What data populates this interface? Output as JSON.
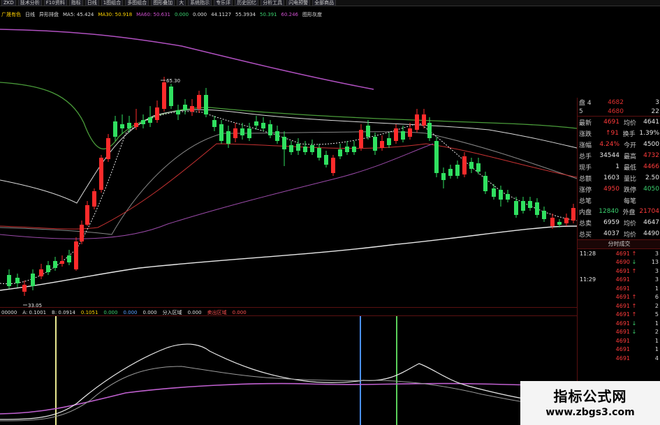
{
  "toolbar": {
    "items": [
      "ZKD",
      "技术分析",
      "F10资料",
      "指标",
      "日线",
      "1图组合",
      "多图组合",
      "图形叠加",
      "大",
      "系统指示",
      "专乐评",
      "历史回忆",
      "分析工具",
      "闪电预警",
      "全部商品"
    ]
  },
  "info": {
    "stock_name": "广晟有色",
    "period": "日线",
    "mode": "异形排盘",
    "ma5": "MA5: 45.424",
    "ma30": "MA30: 50.918",
    "ma60": "MA60: 50.631",
    "ma120": "0.000",
    "ma_b": "0.000",
    "extra1": "44.1127",
    "extra2": "55.3934",
    "extra3": "50.391",
    "extra4": "60.246",
    "extra5": "图形灰度"
  },
  "price_labels": {
    "high": "65.30",
    "low": "33.05"
  },
  "indicator_bar": {
    "name": "00000",
    "a": "A: 0.1001",
    "b": "B: 0.0914",
    "c": "0.1051",
    "d": "0.000",
    "e": "0.000",
    "f": "0.000",
    "g": "0.000",
    "h": "0.000",
    "label_buy": "分入区域",
    "label_sell": "卖出区域"
  },
  "orderbook": [
    {
      "label": "盘 4",
      "price": "4682",
      "vol": "3"
    },
    {
      "label": "5",
      "price": "4680",
      "vol": "22"
    }
  ],
  "quote": [
    {
      "k1": "最新",
      "v1": "4691",
      "k2": "均价",
      "v2": "4641",
      "c1": "red",
      "c2": "white"
    },
    {
      "k1": "涨跌",
      "v1": "↑91",
      "k2": "换手",
      "v2": "1.39%",
      "c1": "red",
      "c2": "white"
    },
    {
      "k1": "涨幅",
      "v1": "4.24%",
      "k2": "今开",
      "v2": "4500",
      "c1": "red",
      "c2": "white"
    },
    {
      "k1": "总手",
      "v1": "34544",
      "k2": "最高",
      "v2": "4732",
      "c1": "white",
      "c2": "red"
    },
    {
      "k1": "现手",
      "v1": "1",
      "k2": "最低",
      "v2": "4466",
      "c1": "white",
      "c2": "red"
    },
    {
      "k1": "总额",
      "v1": "1603",
      "k2": "量比",
      "v2": "2.50",
      "c1": "white",
      "c2": "white"
    },
    {
      "k1": "涨停",
      "v1": "4950",
      "k2": "跌停",
      "v2": "4050",
      "c1": "red",
      "c2": "green"
    },
    {
      "k1": "总笔",
      "v1": "",
      "k2": "每笔",
      "v2": "",
      "c1": "white",
      "c2": "white"
    },
    {
      "k1": "内盘",
      "v1": "12840",
      "k2": "外盘",
      "v2": "21704",
      "c1": "green",
      "c2": "red"
    },
    {
      "k1": "总卖",
      "v1": "6959",
      "k2": "均价",
      "v2": "4647",
      "c1": "white",
      "c2": "white"
    },
    {
      "k1": "总买",
      "v1": "4037",
      "k2": "均价",
      "v2": "4490",
      "c1": "white",
      "c2": "white"
    }
  ],
  "ticks_header": "分时成交",
  "ticks": [
    {
      "time": "11:28",
      "price": "4691",
      "arrow": "↑",
      "vol": "3",
      "ac": "red"
    },
    {
      "time": "",
      "price": "4690",
      "arrow": "↓",
      "vol": "13",
      "ac": "green"
    },
    {
      "time": "",
      "price": "4691",
      "arrow": "↑",
      "vol": "3",
      "ac": "red"
    },
    {
      "time": "11:29",
      "price": "4691",
      "arrow": "",
      "vol": "3",
      "ac": "red"
    },
    {
      "time": "",
      "price": "4691",
      "arrow": "",
      "vol": "1",
      "ac": "red"
    },
    {
      "time": "",
      "price": "4691",
      "arrow": "↑",
      "vol": "6",
      "ac": "red"
    },
    {
      "time": "",
      "price": "4691",
      "arrow": "↑",
      "vol": "2",
      "ac": "red"
    },
    {
      "time": "",
      "price": "4691",
      "arrow": "↑",
      "vol": "5",
      "ac": "red"
    },
    {
      "time": "",
      "price": "4691",
      "arrow": "↓",
      "vol": "1",
      "ac": "green"
    },
    {
      "time": "",
      "price": "4691",
      "arrow": "↓",
      "vol": "2",
      "ac": "green"
    },
    {
      "time": "",
      "price": "4691",
      "arrow": "",
      "vol": "1",
      "ac": "red"
    },
    {
      "time": "",
      "price": "4691",
      "arrow": "",
      "vol": "1",
      "ac": "red"
    },
    {
      "time": "",
      "price": "4691",
      "arrow": "",
      "vol": "4",
      "ac": "red"
    }
  ],
  "watermark": {
    "title": "指标公式网",
    "url": "www.zbgs3.com"
  }
}
